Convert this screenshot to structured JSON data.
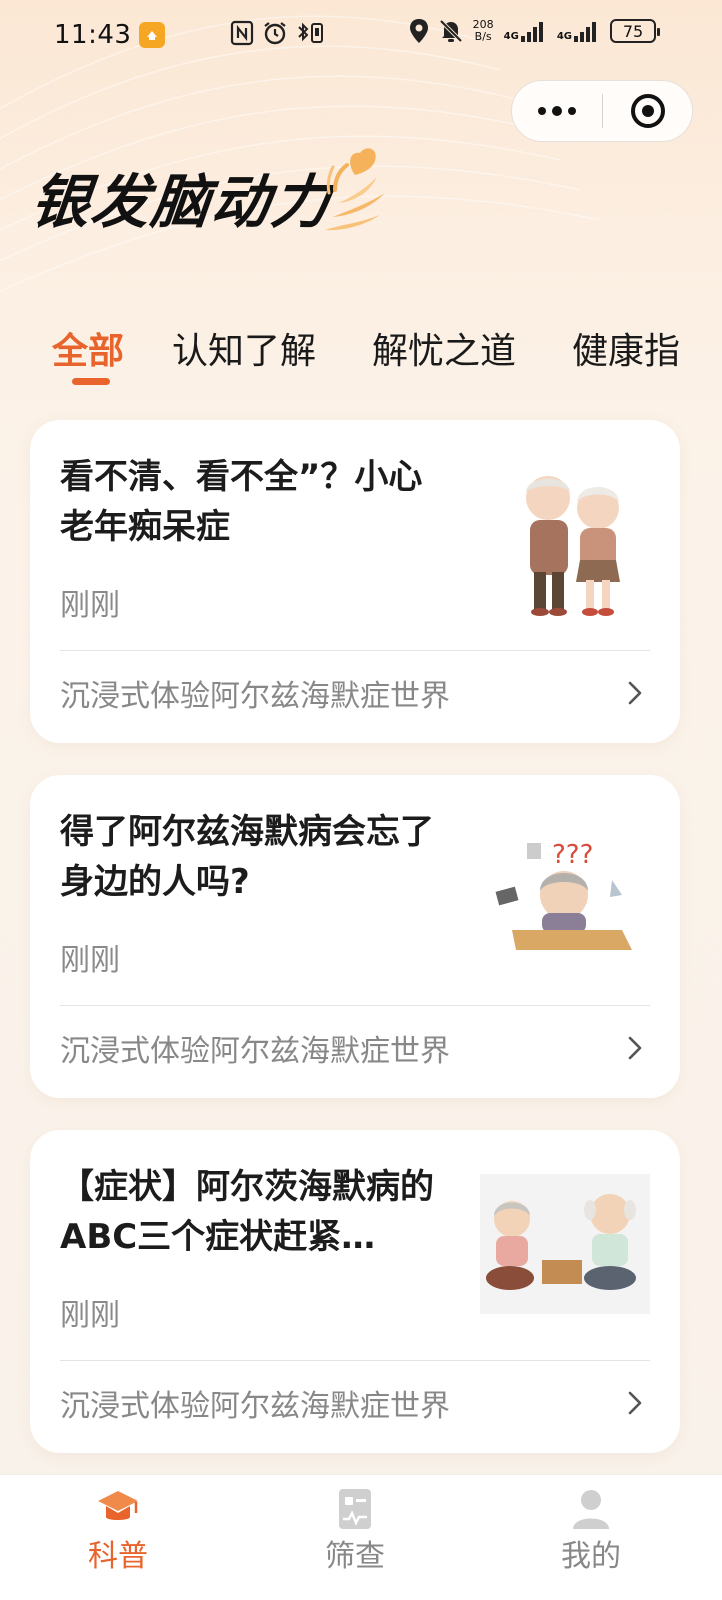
{
  "status_bar": {
    "time": "11:43",
    "net_speed_top": "208",
    "net_speed_bottom": "B/s",
    "signal_1": "4G",
    "signal_2": "4G",
    "battery": "75"
  },
  "header": {
    "logo_text": "银发脑动力"
  },
  "tabs": [
    {
      "label": "全部",
      "active": true
    },
    {
      "label": "认知了解",
      "active": false
    },
    {
      "label": "解忧之道",
      "active": false
    },
    {
      "label": "健康指",
      "active": false
    }
  ],
  "articles": [
    {
      "title": "看不清、看不全”？小心老年痴呆症",
      "time": "刚刚",
      "link_text": "沉浸式体验阿尔兹海默症世界",
      "thumbnail_icon": "elderly-couple-illustration"
    },
    {
      "title": "得了阿尔兹海默病会忘了身边的人吗?",
      "time": "刚刚",
      "link_text": "沉浸式体验阿尔兹海默症世界",
      "thumbnail_icon": "confused-grandma-illustration"
    },
    {
      "title": "【症状】阿尔茨海默病的ABC三个症状赶紧…",
      "time": "刚刚",
      "link_text": "沉浸式体验阿尔兹海默症世界",
      "thumbnail_icon": "elderly-couple-tea-illustration"
    }
  ],
  "bottom_nav": [
    {
      "label": "科普",
      "icon": "graduation-cap-icon",
      "active": true
    },
    {
      "label": "筛查",
      "icon": "checklist-icon",
      "active": false
    },
    {
      "label": "我的",
      "icon": "person-icon",
      "active": false
    }
  ],
  "colors": {
    "accent": "#e8642c",
    "background": "#fbf3ea",
    "card": "#ffffff",
    "muted_text": "#888888"
  }
}
